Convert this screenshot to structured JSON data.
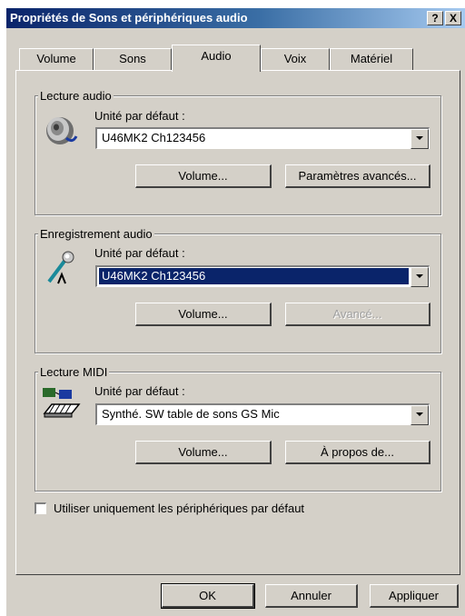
{
  "window": {
    "title": "Propriétés de Sons et périphériques audio",
    "help": "?",
    "close": "X"
  },
  "tabs": [
    "Volume",
    "Sons",
    "Audio",
    "Voix",
    "Matériel"
  ],
  "audio_playback": {
    "title": "Lecture audio",
    "label": "Unité par défaut :",
    "device": "U46MK2 Ch123456",
    "volume": "Volume...",
    "advanced": "Paramètres avancés..."
  },
  "audio_recording": {
    "title": "Enregistrement audio",
    "label": "Unité par défaut :",
    "device": "U46MK2 Ch123456",
    "volume": "Volume...",
    "advanced": "Avancé..."
  },
  "midi_playback": {
    "title": "Lecture MIDI",
    "label": "Unité par défaut :",
    "device": "Synthé. SW table de sons GS Mic",
    "volume": "Volume...",
    "about": "À propos de..."
  },
  "default_only": {
    "label": "Utiliser uniquement les périphériques par défaut",
    "checked": false
  },
  "footer": {
    "ok": "OK",
    "cancel": "Annuler",
    "apply": "Appliquer"
  },
  "colors": {
    "titlebar": "#0a246a",
    "face": "#d4d0c8",
    "selection": "#0a246a"
  }
}
